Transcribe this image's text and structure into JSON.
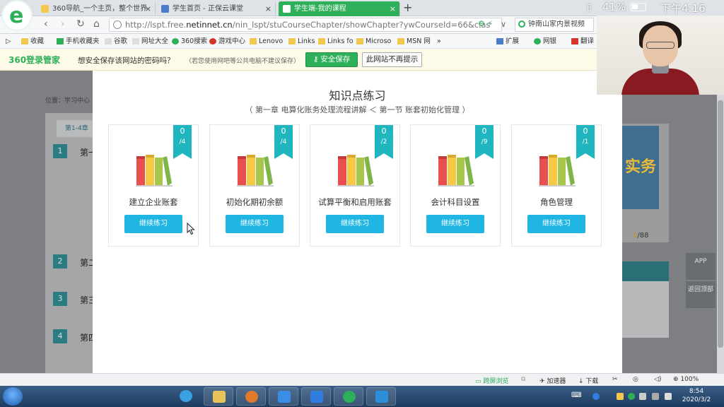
{
  "browser": {
    "tabs": [
      {
        "label": "360导航_一个主页，整个世界",
        "active": false
      },
      {
        "label": "学生首页 - 正保云课堂",
        "active": false
      },
      {
        "label": "学生端-我的课程",
        "active": true
      }
    ],
    "new_tab": "+",
    "url_prefix": "http://lspt.free.",
    "url_domain": "netinnet.cn",
    "url_rest": "/nin_lspt/stuCourseChapter/showChapter?ywCourseId=66&clas",
    "search_text": "钟南山家内景视频",
    "bookmarks": [
      "收藏",
      "手机收藏夹",
      "谷歌",
      "网址大全",
      "360搜索",
      "游戏中心",
      "Lenovo",
      "Links",
      "Links fo",
      "Microso",
      "MSN 网",
      "»",
      "扩展",
      "网银",
      "翻译"
    ]
  },
  "password_bar": {
    "brand": "360登录管家",
    "message": "想安全保存该网站的密码吗？",
    "note": "（若您使用网吧等公共电脑不建议保存）",
    "save_label": "安全保存",
    "dismiss_label": "此网站不再提示"
  },
  "background": {
    "breadcrumb": "位置：学习中心",
    "active_tab": "第1-4章",
    "chapters": [
      {
        "num": "1",
        "head": "第一"
      },
      {
        "num": "2",
        "head": "第二"
      },
      {
        "num": "3",
        "head": "第三"
      },
      {
        "num": "4",
        "head": "第四"
      }
    ],
    "banner_text": "实务",
    "count_done": "0",
    "count_total": "/88",
    "side_buttons": [
      "APP",
      "返回顶部"
    ]
  },
  "modal": {
    "title": "知识点练习",
    "subtitle": "（ 第一章 电算化账务处理流程讲解 ＜ 第一节 账套初始化管理 ）",
    "cards": [
      {
        "name": "建立企业账套",
        "done": "0",
        "total": "/4",
        "button": "继续练习"
      },
      {
        "name": "初始化期初余额",
        "done": "0",
        "total": "/4",
        "button": "继续练习"
      },
      {
        "name": "试算平衡和启用账套",
        "done": "0",
        "total": "/2",
        "button": "继续练习"
      },
      {
        "name": "会计科目设置",
        "done": "0",
        "total": "/9",
        "button": "继续练习"
      },
      {
        "name": "角色管理",
        "done": "0",
        "total": "/1",
        "button": "继续练习"
      }
    ],
    "colors": {
      "accent": "#1fb6e4",
      "ribbon": "#1fb6c0"
    }
  },
  "status_bar": {
    "split_view": "跨屏浏览",
    "accelerator": "加速器",
    "download": "下载",
    "zoom": "100%"
  },
  "taskbar": {
    "time": "8:54",
    "date": "2020/3/2"
  },
  "phone_status": {
    "battery": "41%",
    "time": "下午4:16"
  },
  "rec_logo": "e"
}
